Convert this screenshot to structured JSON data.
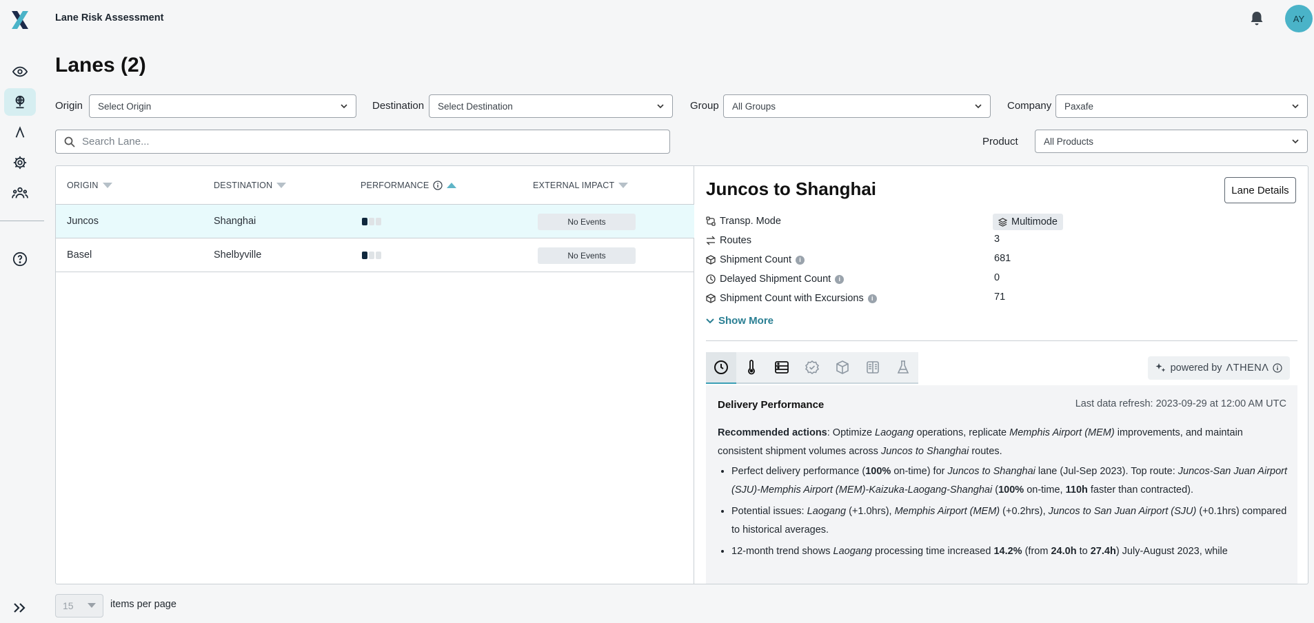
{
  "app": {
    "title": "Lane Risk Assessment",
    "user_initials": "AY",
    "brand_color": "#4ab3c8"
  },
  "nav": {
    "items": [
      {
        "name": "visibility",
        "icon": "eye-icon"
      },
      {
        "name": "lanes",
        "icon": "globe-icon",
        "active": true
      },
      {
        "name": "athena",
        "icon": "athena-icon"
      },
      {
        "name": "settings",
        "icon": "gear-icon"
      },
      {
        "name": "users",
        "icon": "users-icon"
      },
      {
        "name": "help",
        "icon": "help-icon"
      }
    ]
  },
  "page": {
    "title": "Lanes (2)"
  },
  "filters": {
    "origin_label": "Origin",
    "origin_value": "Select Origin",
    "destination_label": "Destination",
    "destination_value": "Select Destination",
    "group_label": "Group",
    "group_value": "All Groups",
    "company_label": "Company",
    "company_value": "Paxafe",
    "product_label": "Product",
    "product_value": "All Products",
    "search_placeholder": "Search Lane..."
  },
  "table": {
    "columns": [
      "ORIGIN",
      "DESTINATION",
      "PERFORMANCE",
      "EXTERNAL IMPACT"
    ],
    "rows": [
      {
        "origin": "Juncos",
        "destination": "Shanghai",
        "performance_level": 1,
        "impact": "No Events",
        "selected": true
      },
      {
        "origin": "Basel",
        "destination": "Shelbyville",
        "performance_level": 1,
        "impact": "No Events",
        "selected": false
      }
    ]
  },
  "detail": {
    "title": "Juncos to Shanghai",
    "lane_details_button": "Lane Details",
    "props": [
      {
        "label": "Transp. Mode",
        "value": "Multimode",
        "icon": "transport-icon"
      },
      {
        "label": "Routes",
        "value": "3",
        "icon": "routes-icon"
      },
      {
        "label": "Shipment Count",
        "value": "681",
        "icon": "box-icon",
        "info": true
      },
      {
        "label": "Delayed Shipment Count",
        "value": "0",
        "icon": "clock-icon",
        "info": true
      },
      {
        "label": "Shipment Count with Excursions",
        "value": "71",
        "icon": "box-icon",
        "info": true
      }
    ],
    "show_more": "Show More",
    "tabs": [
      "clock-icon",
      "thermometer-icon",
      "server-icon",
      "badge-check-icon",
      "box-icon",
      "document-icon",
      "flask-icon"
    ],
    "powered_by": "powered by",
    "athena_brand": "ΛTHENΛ",
    "content": {
      "heading": "Delivery Performance",
      "refresh": "Last data refresh: 2023-09-29 at 12:00 AM UTC",
      "rec_label": "Recommended actions",
      "rec_parts": [
        ": Optimize ",
        "Laogang",
        " operations, replicate ",
        "Memphis Airport (MEM)",
        " improvements, and maintain consistent shipment volumes across ",
        "Juncos to Shanghai",
        " routes."
      ],
      "bullet1": [
        "Perfect delivery performance (",
        "100%",
        " on-time) for ",
        "Juncos to Shanghai",
        " lane (Jul-Sep 2023). Top route: ",
        "Juncos-San Juan Airport (SJU)-Memphis Airport (MEM)-Kaizuka-Laogang-Shanghai",
        " (",
        "100%",
        " on-time, ",
        "110h",
        " faster than contracted)."
      ],
      "bullet2": [
        "Potential issues: ",
        "Laogang",
        " (+1.0hrs), ",
        "Memphis Airport (MEM)",
        " (+0.2hrs), ",
        "Juncos to San Juan Airport (SJU)",
        " (+0.1hrs) compared to historical averages."
      ],
      "bullet3": [
        "12-month trend shows ",
        "Laogang",
        " processing time increased ",
        "14.2%",
        " (from ",
        "24.0h",
        " to ",
        "27.4h",
        ") July-August 2023, while"
      ]
    }
  },
  "pager": {
    "per_page": "15",
    "label": "items per page"
  }
}
